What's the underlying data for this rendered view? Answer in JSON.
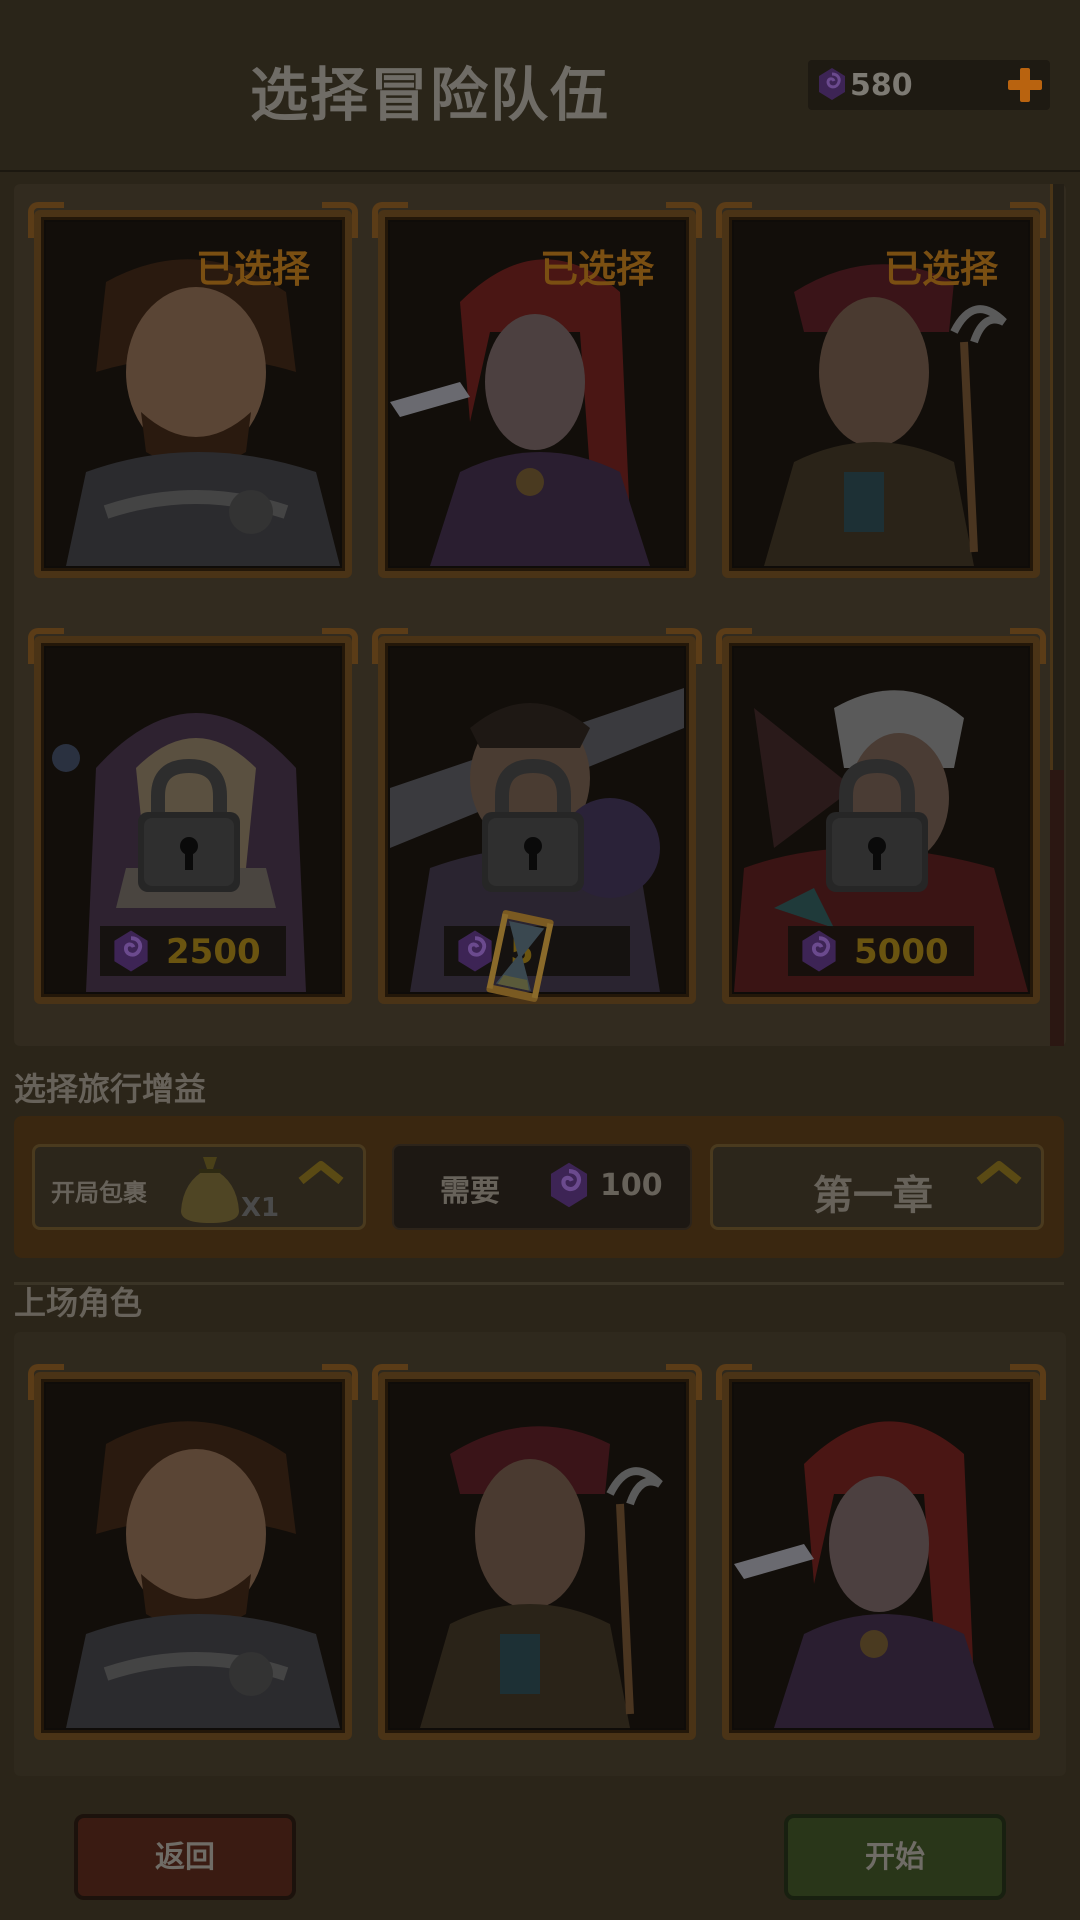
{
  "header": {
    "title": "选择冒险队伍",
    "currency": "580"
  },
  "roster": {
    "heroes": [
      {
        "name": "warrior",
        "status": "已选择"
      },
      {
        "name": "rogue",
        "status": "已选择"
      },
      {
        "name": "mystic",
        "status": "已选择"
      },
      {
        "name": "nun",
        "price": "2500"
      },
      {
        "name": "brute",
        "price": "5"
      },
      {
        "name": "witch",
        "price": "5000"
      }
    ]
  },
  "buff_section": {
    "title": "选择旅行增益",
    "pack_label": "开局包裹",
    "pack_count": "X1",
    "need_label": "需要",
    "need_cost": "100",
    "chapter": "第一章"
  },
  "party_section": {
    "title": "上场角色"
  },
  "buttons": {
    "back": "返回",
    "start": "开始"
  },
  "colors": {
    "gem": "#4a2a6a",
    "accent_orange": "#b9630f",
    "selected_text": "#7a4f12"
  },
  "icons": [
    "gem-icon",
    "plus-icon",
    "lock-icon",
    "hourglass-icon",
    "bag-icon",
    "chevron-up-icon"
  ]
}
